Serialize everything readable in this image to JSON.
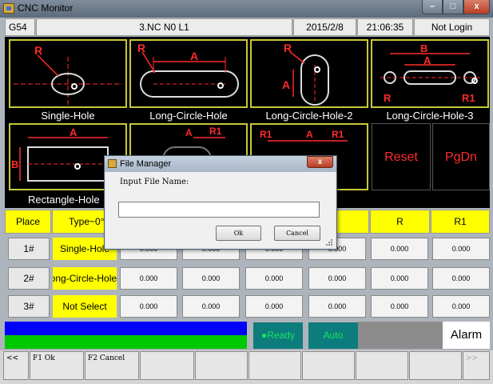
{
  "window": {
    "title": "CNC Monitor",
    "min": "‒",
    "max": "□",
    "close": "x"
  },
  "status": {
    "coord": "G54",
    "program": "3.NC N0 L1",
    "date": "2015/2/8",
    "time": "21:06:35",
    "login": "Not Login"
  },
  "tiles": [
    {
      "label": "Single-Hole"
    },
    {
      "label": "Long-Circle-Hole"
    },
    {
      "label": "Long-Circle-Hole-2"
    },
    {
      "label": "Long-Circle-Hole-3"
    },
    {
      "label": "Rectangle-Hole"
    }
  ],
  "diagram_marks": {
    "r": "R",
    "a": "A",
    "b": "B",
    "r1": "R1"
  },
  "actions": {
    "reset": "Reset",
    "pgdn": "PgDn"
  },
  "table": {
    "headers": {
      "place": "Place",
      "type": "Type~0°",
      "r": "R",
      "r1": "R1"
    },
    "rows": [
      {
        "place": "1#",
        "type": "Single-Hole",
        "values": [
          "0.000",
          "0.000",
          "0.000",
          "0.000",
          "0.000",
          "0.000"
        ]
      },
      {
        "place": "2#",
        "type": "Long-Circle-Hole-",
        "values": [
          "0.000",
          "0.000",
          "0.000",
          "0.000",
          "0.000",
          "0.000"
        ]
      },
      {
        "place": "3#",
        "type": "Not Select",
        "values": [
          "0.000",
          "0.000",
          "0.000",
          "0.000",
          "0.000",
          "0.000"
        ]
      }
    ]
  },
  "machine": {
    "ready": "●Ready",
    "auto": "Auto",
    "alarm": "Alarm"
  },
  "fkeys": {
    "prev": "<<",
    "f1": "F1 Ok",
    "f2": "F2 Cancel",
    "next": ">>"
  },
  "dialog": {
    "title": "File Manager",
    "close": "x",
    "prompt": "Input File Name:",
    "input_value": "",
    "ok": "Ok",
    "cancel": "Cancel"
  },
  "colors": {
    "tile_border": "#c8c83a",
    "red": "#ff2a2a",
    "yellow": "#ffff00",
    "teal": "#0d7c7c",
    "ready_green": "#18e660"
  }
}
